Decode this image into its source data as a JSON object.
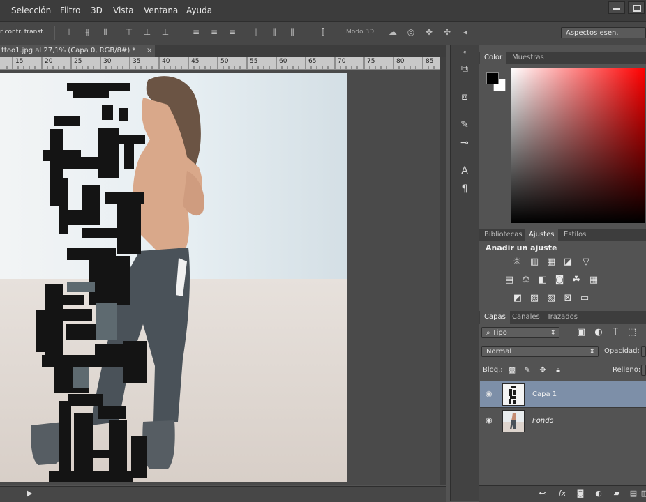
{
  "menu": [
    "Selección",
    "Filtro",
    "3D",
    "Vista",
    "Ventana",
    "Ayuda"
  ],
  "options_bar": {
    "transform_label": "r contr. transf.",
    "mode3d_label": "Modo 3D:",
    "workspace": "Aspectos esen."
  },
  "document": {
    "tab_title": "ttoo1.jpg al 27,1% (Capa 0, RGB/8#) *",
    "close_icon": "close-icon"
  },
  "ruler": {
    "ticks": [
      "15",
      "20",
      "25",
      "30",
      "35",
      "40",
      "45",
      "50",
      "55",
      "60",
      "65",
      "70",
      "75",
      "80",
      "85"
    ]
  },
  "color_panel": {
    "tabs": [
      "Color",
      "Muestras"
    ],
    "foreground": "#000000",
    "background": "#ffffff",
    "hue": "#ff0000"
  },
  "adjustments_panel": {
    "tabs": [
      "Bibliotecas",
      "Ajustes",
      "Estilos"
    ],
    "title": "Añadir un ajuste"
  },
  "layers_panel": {
    "tabs": [
      "Capas",
      "Canales",
      "Trazados"
    ],
    "filter": "Tipo",
    "blend_mode": "Normal",
    "opacity_label": "Opacidad:",
    "lock_label": "Bloq.:",
    "fill_label": "Relleno:",
    "layers": [
      {
        "name": "Capa 1",
        "selected": true
      },
      {
        "name": "Fondo",
        "selected": false
      }
    ]
  }
}
